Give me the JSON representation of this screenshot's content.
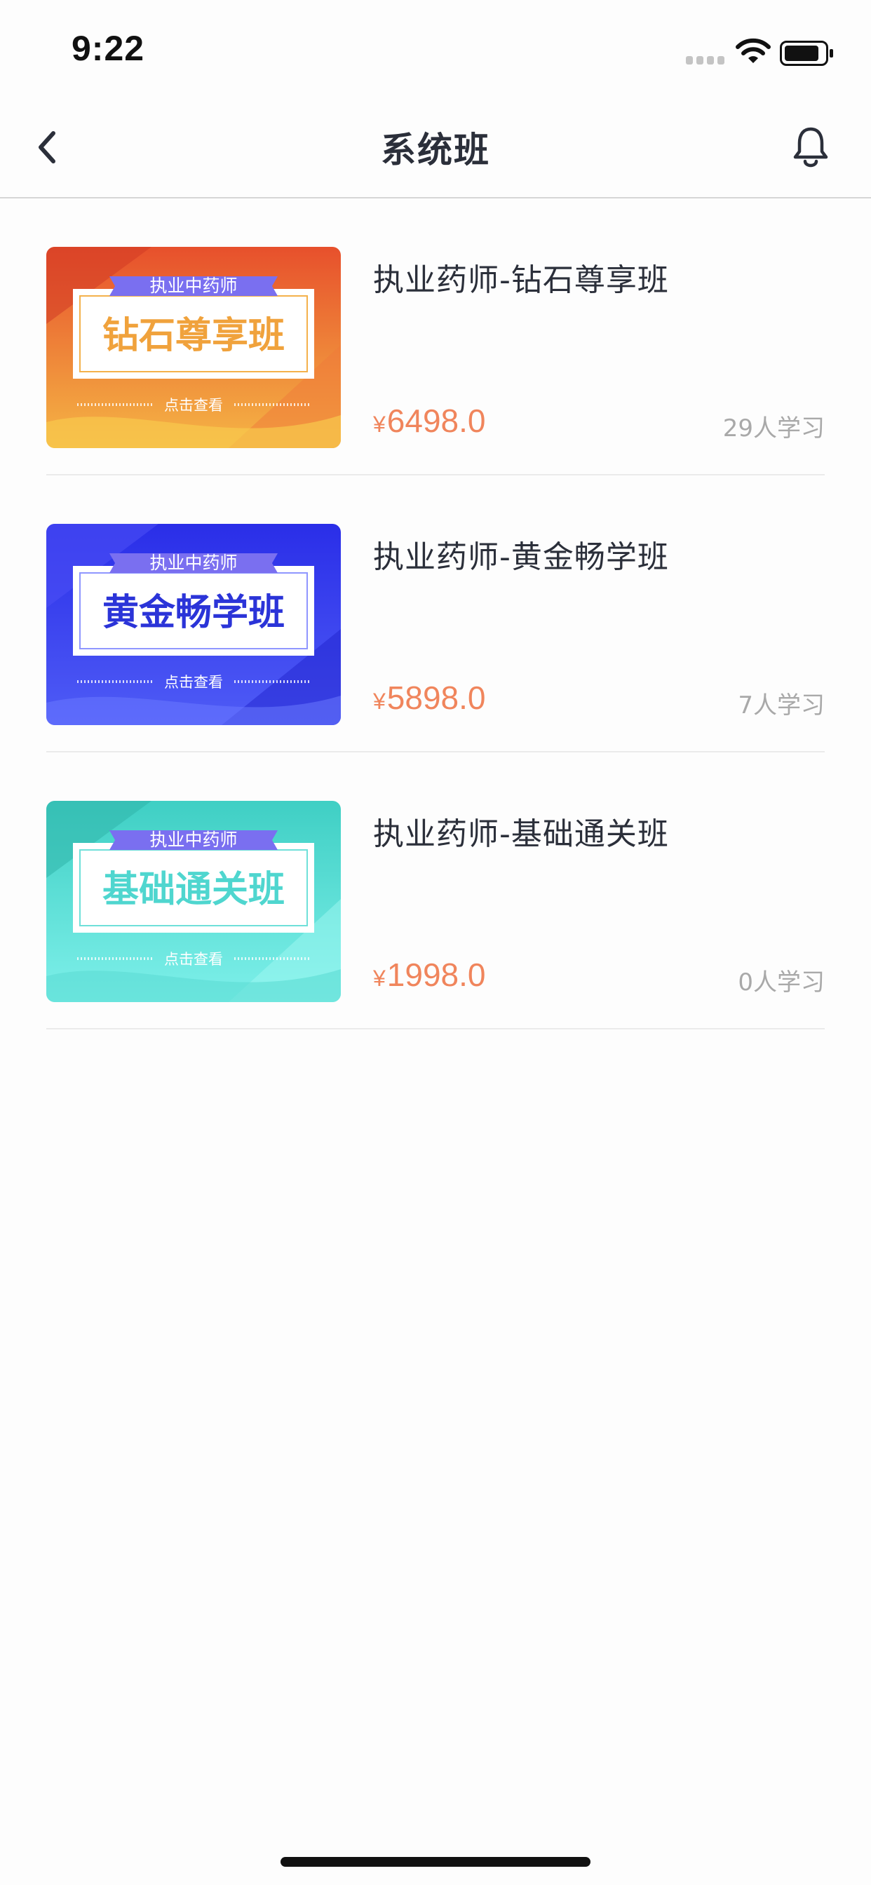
{
  "status_bar": {
    "time": "9:22"
  },
  "nav": {
    "title": "系统班"
  },
  "courses": [
    {
      "title": "执业药师-钻石尊享班",
      "price_symbol": "¥",
      "price": "6498.0",
      "learners": "29人学习",
      "thumb": {
        "ribbon": "执业中药师",
        "headline": "钻石尊享班",
        "cta": "点击查看",
        "colors": {
          "top": "#e7502c",
          "bottom": "#f5b545",
          "headline": "#f0a23c"
        }
      }
    },
    {
      "title": "执业药师-黄金畅学班",
      "price_symbol": "¥",
      "price": "5898.0",
      "learners": "7人学习",
      "thumb": {
        "ribbon": "执业中药师",
        "headline": "黄金畅学班",
        "cta": "点击查看",
        "colors": {
          "top": "#2a2ee8",
          "bottom": "#4f5cf6",
          "headline": "#2b34d8"
        }
      }
    },
    {
      "title": "执业药师-基础通关班",
      "price_symbol": "¥",
      "price": "1998.0",
      "learners": "0人学习",
      "thumb": {
        "ribbon": "执业中药师",
        "headline": "基础通关班",
        "cta": "点击查看",
        "colors": {
          "top": "#3fcfc4",
          "bottom": "#7ef0ea",
          "headline": "#4fd6cf"
        }
      }
    }
  ],
  "theme": {
    "accent_price": "#f0855c",
    "ribbon": "#7a6ff0"
  }
}
